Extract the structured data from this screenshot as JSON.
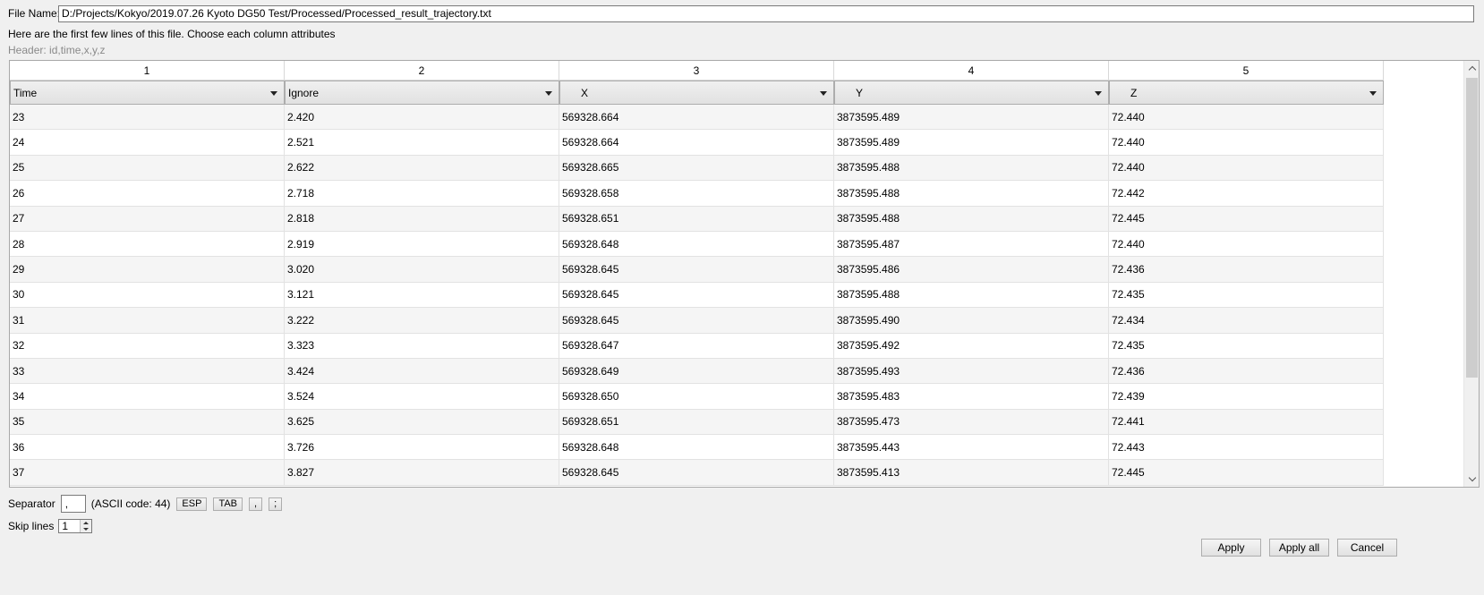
{
  "file": {
    "label": "File Name:",
    "path": "D:/Projects/Kokyo/2019.07.26 Kyoto DG50 Test/Processed/Processed_result_trajectory.txt"
  },
  "info_text": "Here are the first few lines of this file. Choose each column attributes",
  "header_text": "Header: id,time,x,y,z",
  "table": {
    "column_numbers": [
      "1",
      "2",
      "3",
      "4",
      "5"
    ],
    "column_attributes": [
      "Time",
      "Ignore",
      "X",
      "Y",
      "Z"
    ],
    "rows": [
      [
        "23",
        "2.420",
        "569328.664",
        "3873595.489",
        "72.440"
      ],
      [
        "24",
        "2.521",
        "569328.664",
        "3873595.489",
        "72.440"
      ],
      [
        "25",
        "2.622",
        "569328.665",
        "3873595.488",
        "72.440"
      ],
      [
        "26",
        "2.718",
        "569328.658",
        "3873595.488",
        "72.442"
      ],
      [
        "27",
        "2.818",
        "569328.651",
        "3873595.488",
        "72.445"
      ],
      [
        "28",
        "2.919",
        "569328.648",
        "3873595.487",
        "72.440"
      ],
      [
        "29",
        "3.020",
        "569328.645",
        "3873595.486",
        "72.436"
      ],
      [
        "30",
        "3.121",
        "569328.645",
        "3873595.488",
        "72.435"
      ],
      [
        "31",
        "3.222",
        "569328.645",
        "3873595.490",
        "72.434"
      ],
      [
        "32",
        "3.323",
        "569328.647",
        "3873595.492",
        "72.435"
      ],
      [
        "33",
        "3.424",
        "569328.649",
        "3873595.493",
        "72.436"
      ],
      [
        "34",
        "3.524",
        "569328.650",
        "3873595.483",
        "72.439"
      ],
      [
        "35",
        "3.625",
        "569328.651",
        "3873595.473",
        "72.441"
      ],
      [
        "36",
        "3.726",
        "569328.648",
        "3873595.443",
        "72.443"
      ],
      [
        "37",
        "3.827",
        "569328.645",
        "3873595.413",
        "72.445"
      ]
    ]
  },
  "separator": {
    "label": "Separator",
    "value": ",",
    "ascii_text": "(ASCII code: 44)",
    "buttons": [
      "ESP",
      "TAB",
      ",",
      ";"
    ]
  },
  "skip": {
    "label": "Skip lines",
    "value": "1"
  },
  "actions": {
    "apply": "Apply",
    "apply_all": "Apply all",
    "cancel": "Cancel"
  }
}
